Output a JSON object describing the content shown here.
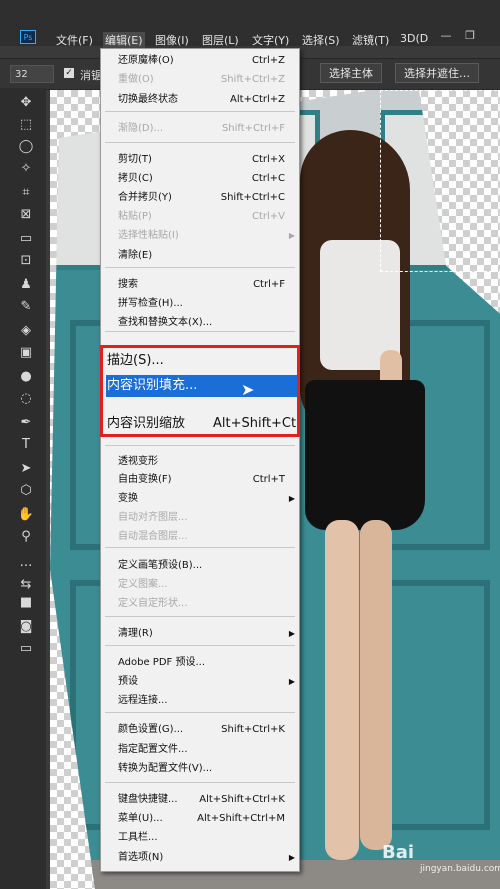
{
  "menubar": {
    "logo": "Ps",
    "items": [
      "文件(F)",
      "编辑(E)",
      "图像(I)",
      "图层(L)",
      "文字(Y)",
      "选择(S)",
      "滤镜(T)",
      "3D(D"
    ],
    "active_index": 1,
    "window_buttons": [
      "—",
      "❐"
    ]
  },
  "optionsbar": {
    "size_value": "32",
    "checkbox_label": "消锯齿",
    "select_subject": "选择主体",
    "select_mask": "选择并遮住…"
  },
  "toolbar": {
    "tools": [
      "move-icon",
      "marquee-icon",
      "lasso-icon",
      "magic-wand-icon",
      "crop-icon",
      "frame-icon",
      "ruler-icon",
      "patch-icon",
      "stamp-icon",
      "brush-icon",
      "eraser-icon",
      "gradient-icon",
      "blur-icon",
      "dodge-icon",
      "pen-icon",
      "type-icon",
      "path-select-icon",
      "shape-icon",
      "hand-icon",
      "zoom-icon",
      "more-icon",
      "swap-colors-icon",
      "color-swatch-icon",
      "quick-mask-icon",
      "screen-mode-icon"
    ],
    "glyphs": [
      "✥",
      "⬚",
      "◯",
      "✧",
      "⌗",
      "⊠",
      "▭",
      "⊡",
      "♟",
      "✎",
      "◈",
      "▣",
      "●",
      "◌",
      "✒",
      "T",
      "➤",
      "⬡",
      "✋",
      "⚲",
      "…",
      "⇆",
      "■",
      "◙",
      "▭"
    ]
  },
  "edit_menu": {
    "items": [
      {
        "label": "还原魔棒(O)",
        "shortcut": "Ctrl+Z",
        "disabled": false
      },
      {
        "label": "重做(O)",
        "shortcut": "Shift+Ctrl+Z",
        "disabled": true
      },
      {
        "label": "切换最终状态",
        "shortcut": "Alt+Ctrl+Z",
        "disabled": false
      },
      {
        "label": "渐隐(D)...",
        "shortcut": "Shift+Ctrl+F",
        "disabled": true
      },
      {
        "label": "剪切(T)",
        "shortcut": "Ctrl+X",
        "disabled": false
      },
      {
        "label": "拷贝(C)",
        "shortcut": "Ctrl+C",
        "disabled": false
      },
      {
        "label": "合并拷贝(Y)",
        "shortcut": "Shift+Ctrl+C",
        "disabled": false
      },
      {
        "label": "粘贴(P)",
        "shortcut": "Ctrl+V",
        "disabled": true
      },
      {
        "label": "选择性粘贴(I)",
        "shortcut": "",
        "disabled": true,
        "submenu": true
      },
      {
        "label": "清除(E)",
        "shortcut": "",
        "disabled": false
      },
      {
        "label": "搜索",
        "shortcut": "Ctrl+F",
        "disabled": false
      },
      {
        "label": "拼写检查(H)...",
        "shortcut": "",
        "disabled": false
      },
      {
        "label": "查找和替换文本(X)...",
        "shortcut": "",
        "disabled": false
      },
      {
        "label": "透视变形",
        "shortcut": "",
        "disabled": false
      },
      {
        "label": "自由变换(F)",
        "shortcut": "Ctrl+T",
        "disabled": false
      },
      {
        "label": "变换",
        "shortcut": "",
        "disabled": false,
        "submenu": true
      },
      {
        "label": "自动对齐图层...",
        "shortcut": "",
        "disabled": true
      },
      {
        "label": "自动混合图层...",
        "shortcut": "",
        "disabled": true
      },
      {
        "label": "定义画笔预设(B)...",
        "shortcut": "",
        "disabled": false
      },
      {
        "label": "定义图案...",
        "shortcut": "",
        "disabled": true
      },
      {
        "label": "定义自定形状...",
        "shortcut": "",
        "disabled": true
      },
      {
        "label": "清理(R)",
        "shortcut": "",
        "disabled": false,
        "submenu": true
      },
      {
        "label": "Adobe PDF 预设...",
        "shortcut": "",
        "disabled": false
      },
      {
        "label": "预设",
        "shortcut": "",
        "disabled": false,
        "submenu": true
      },
      {
        "label": "远程连接...",
        "shortcut": "",
        "disabled": false
      },
      {
        "label": "颜色设置(G)...",
        "shortcut": "Shift+Ctrl+K",
        "disabled": false
      },
      {
        "label": "指定配置文件...",
        "shortcut": "",
        "disabled": false
      },
      {
        "label": "转换为配置文件(V)...",
        "shortcut": "",
        "disabled": false
      },
      {
        "label": "键盘快捷键...",
        "shortcut": "Alt+Shift+Ctrl+K",
        "disabled": false
      },
      {
        "label": "菜单(U)...",
        "shortcut": "Alt+Shift+Ctrl+M",
        "disabled": false
      },
      {
        "label": "工具栏...",
        "shortcut": "",
        "disabled": false
      },
      {
        "label": "首选项(N)",
        "shortcut": "",
        "disabled": false,
        "submenu": true
      }
    ],
    "highlight": {
      "stroke": "描边(S)...",
      "content_aware_fill": "内容识别填充...",
      "content_aware_scale": "内容识别缩放",
      "content_aware_scale_shortcut": "Alt+Shift+Ct"
    }
  },
  "watermark": {
    "text": "Bai",
    "sub": "jingyan.baidu.com"
  },
  "colors": {
    "highlight_border": "#e2201c",
    "selection": "#1a6ed8",
    "menu_bg": "#f1f1f1"
  }
}
